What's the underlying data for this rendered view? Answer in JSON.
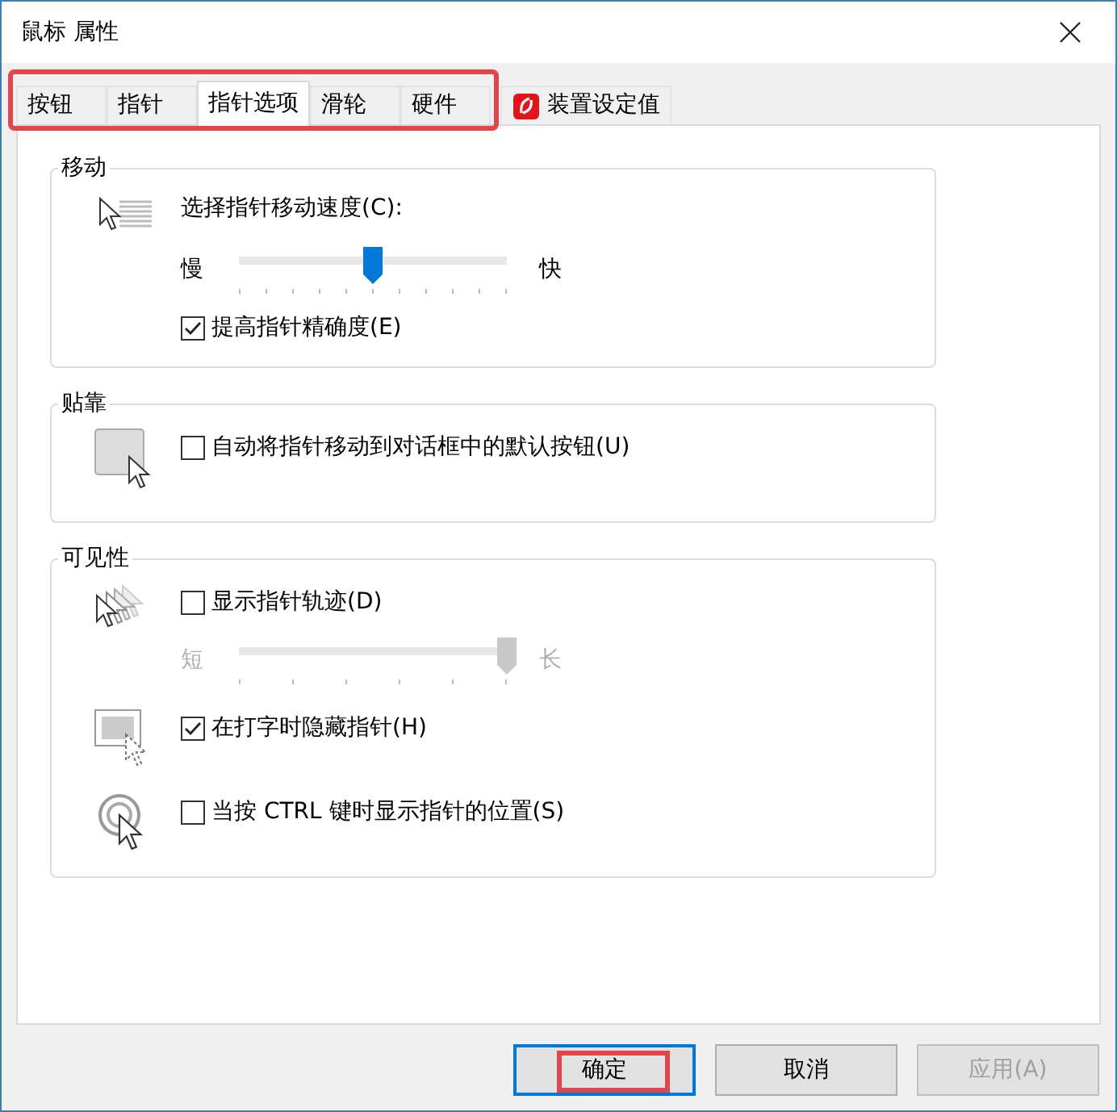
{
  "window": {
    "title": "鼠标 属性"
  },
  "tab_strip": {
    "highlighted": true,
    "tabs": [
      {
        "label": "按钮",
        "selected": false,
        "kind": "plain"
      },
      {
        "label": "指针",
        "selected": false,
        "kind": "plain"
      },
      {
        "label": "指针选项",
        "selected": true,
        "kind": "plain"
      },
      {
        "label": "滑轮",
        "selected": false,
        "kind": "plain"
      },
      {
        "label": "硬件",
        "selected": false,
        "kind": "plain"
      },
      {
        "label": "装置设定值",
        "selected": false,
        "kind": "vendor"
      }
    ]
  },
  "sections": [
    {
      "title": "移动",
      "groups": [
        {
          "items": [
            {
              "kind": "label",
              "label": "选择指针移动速度(C):"
            },
            {
              "kind": "slider",
              "left": "慢",
              "right": "快",
              "level": 0.5,
              "disabled": false
            },
            {
              "kind": "checkbox",
              "label": "提高指针精确度(E)",
              "checked": true
            }
          ]
        }
      ]
    },
    {
      "title": "贴靠",
      "groups": [
        {
          "items": [
            {
              "kind": "checkbox",
              "label": "自动将指针移动到对话框中的默认按钮(U)",
              "checked": false
            }
          ]
        }
      ]
    },
    {
      "title": "可见性",
      "groups": [
        {
          "items": [
            {
              "kind": "checkbox",
              "label": "显示指针轨迹(D)",
              "checked": false
            },
            {
              "kind": "slider",
              "left": "短",
              "right": "长",
              "level": 1,
              "disabled": true
            }
          ]
        },
        {
          "items": [
            {
              "kind": "checkbox",
              "label": "在打字时隐藏指针(H)",
              "checked": true
            }
          ]
        },
        {
          "items": [
            {
              "kind": "checkbox",
              "label": "当按 CTRL 键时显示指针的位置(S)",
              "checked": false
            }
          ]
        }
      ]
    }
  ],
  "buttons": [
    {
      "label": "确定",
      "kind": "default",
      "disabled": false,
      "highlighted": true
    },
    {
      "label": "取消",
      "kind": "normal",
      "disabled": false,
      "highlighted": false
    },
    {
      "label": "应用(A)",
      "kind": "normal",
      "disabled": true,
      "highlighted": false
    }
  ]
}
